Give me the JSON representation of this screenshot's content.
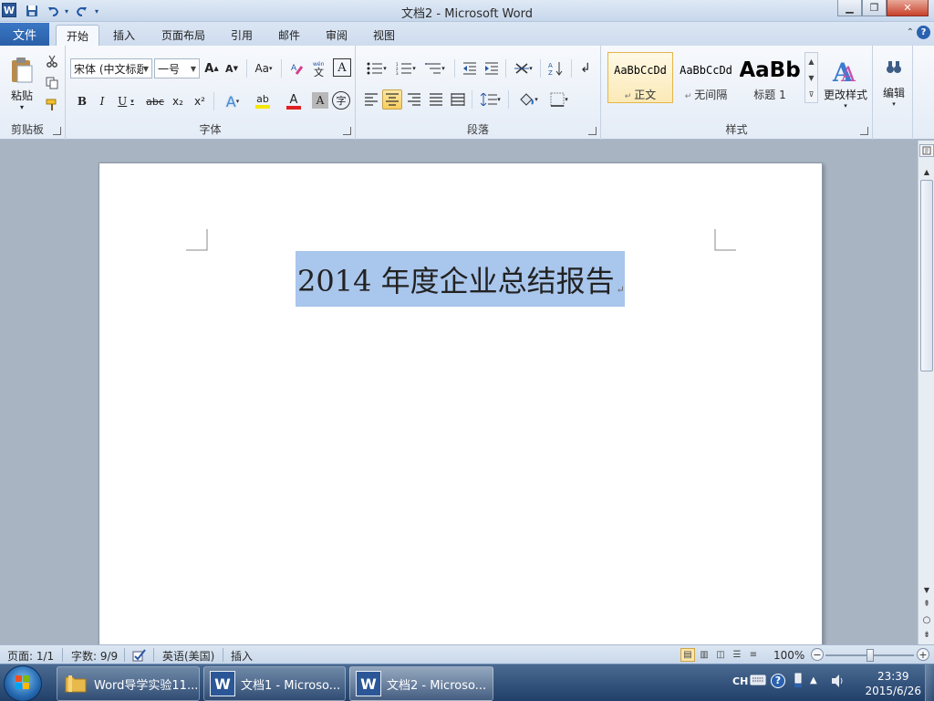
{
  "window": {
    "title": "文档2 - Microsoft Word"
  },
  "tabs": {
    "file": "文件",
    "items": [
      "开始",
      "插入",
      "页面布局",
      "引用",
      "邮件",
      "审阅",
      "视图"
    ],
    "active": "开始"
  },
  "ribbon": {
    "clipboard": {
      "label": "剪贴板",
      "paste": "粘贴"
    },
    "font": {
      "label": "字体",
      "font_name": "宋体 (中文标题",
      "font_size": "一号",
      "grow": "A",
      "shrink": "A",
      "change_case": "Aa",
      "bold": "B",
      "italic": "I",
      "underline": "U",
      "strikethrough": "abc",
      "subscript": "x₂",
      "superscript": "x²",
      "effects": "A",
      "highlight": "ab",
      "font_color": "A",
      "char_shading": "A",
      "enclose": "字",
      "phonetic": "wén",
      "border": "A"
    },
    "paragraph": {
      "label": "段落"
    },
    "styles": {
      "label": "样式",
      "items": [
        {
          "sample": "AaBbCcDd",
          "name": "正文"
        },
        {
          "sample": "AaBbCcDd",
          "name": "无间隔"
        },
        {
          "sample": "AaBb",
          "name": "标题 1"
        }
      ],
      "change_styles": "更改样式"
    },
    "editing": {
      "label": "编辑"
    }
  },
  "document": {
    "heading": "2014 年度企业总结报告"
  },
  "status": {
    "page": "页面: 1/1",
    "words": "字数: 9/9",
    "language": "英语(美国)",
    "mode": "插入",
    "zoom": "100%"
  },
  "zoom_fraction": 0.5,
  "taskbar": {
    "items": [
      {
        "label": "Word导学实验11...",
        "icon": "folder-icon"
      },
      {
        "label": "文档1 - Microso...",
        "icon": "word-icon"
      },
      {
        "label": "文档2 - Microso...",
        "icon": "word-icon"
      }
    ],
    "ime": "CH",
    "time": "23:39",
    "date": "2015/6/26"
  },
  "colors": {
    "accent": "#2b5797",
    "selection": "#a9c6ec",
    "highlight_bar": "#f5e60a",
    "font_red": "#e02020"
  }
}
